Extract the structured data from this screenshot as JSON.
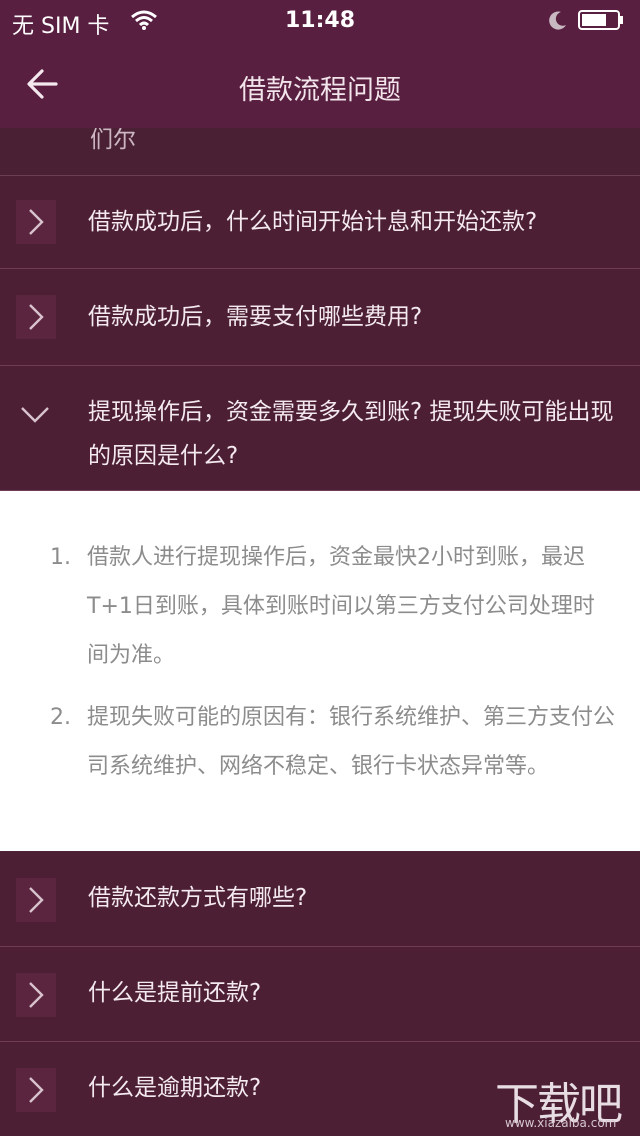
{
  "status_bar": {
    "carrier": "无 SIM 卡",
    "time": "11:48"
  },
  "nav": {
    "title": "借款流程问题"
  },
  "partial_item": {
    "text": "们尔"
  },
  "faq_items": [
    {
      "question": "借款成功后，什么时间开始计息和开始还款?"
    },
    {
      "question": "借款成功后，需要支付哪些费用?"
    },
    {
      "question": "提现操作后，资金需要多久到账? 提现失败可能出现的原因是什么?"
    },
    {
      "question": "借款还款方式有哪些?"
    },
    {
      "question": "什么是提前还款?"
    },
    {
      "question": "什么是逾期还款?"
    }
  ],
  "answer": {
    "points": [
      {
        "num": "1.",
        "text": "借款人进行提现操作后，资金最快2小时到账，最迟T+1日到账，具体到账时间以第三方支付公司处理时间为准。"
      },
      {
        "num": "2.",
        "text": "提现失败可能的原因有：银行系统维护、第三方支付公司系统维护、网络不稳定、银行卡状态异常等。"
      }
    ]
  },
  "watermark": {
    "main": "下载吧",
    "sub": "www.xiazaiba.com"
  }
}
